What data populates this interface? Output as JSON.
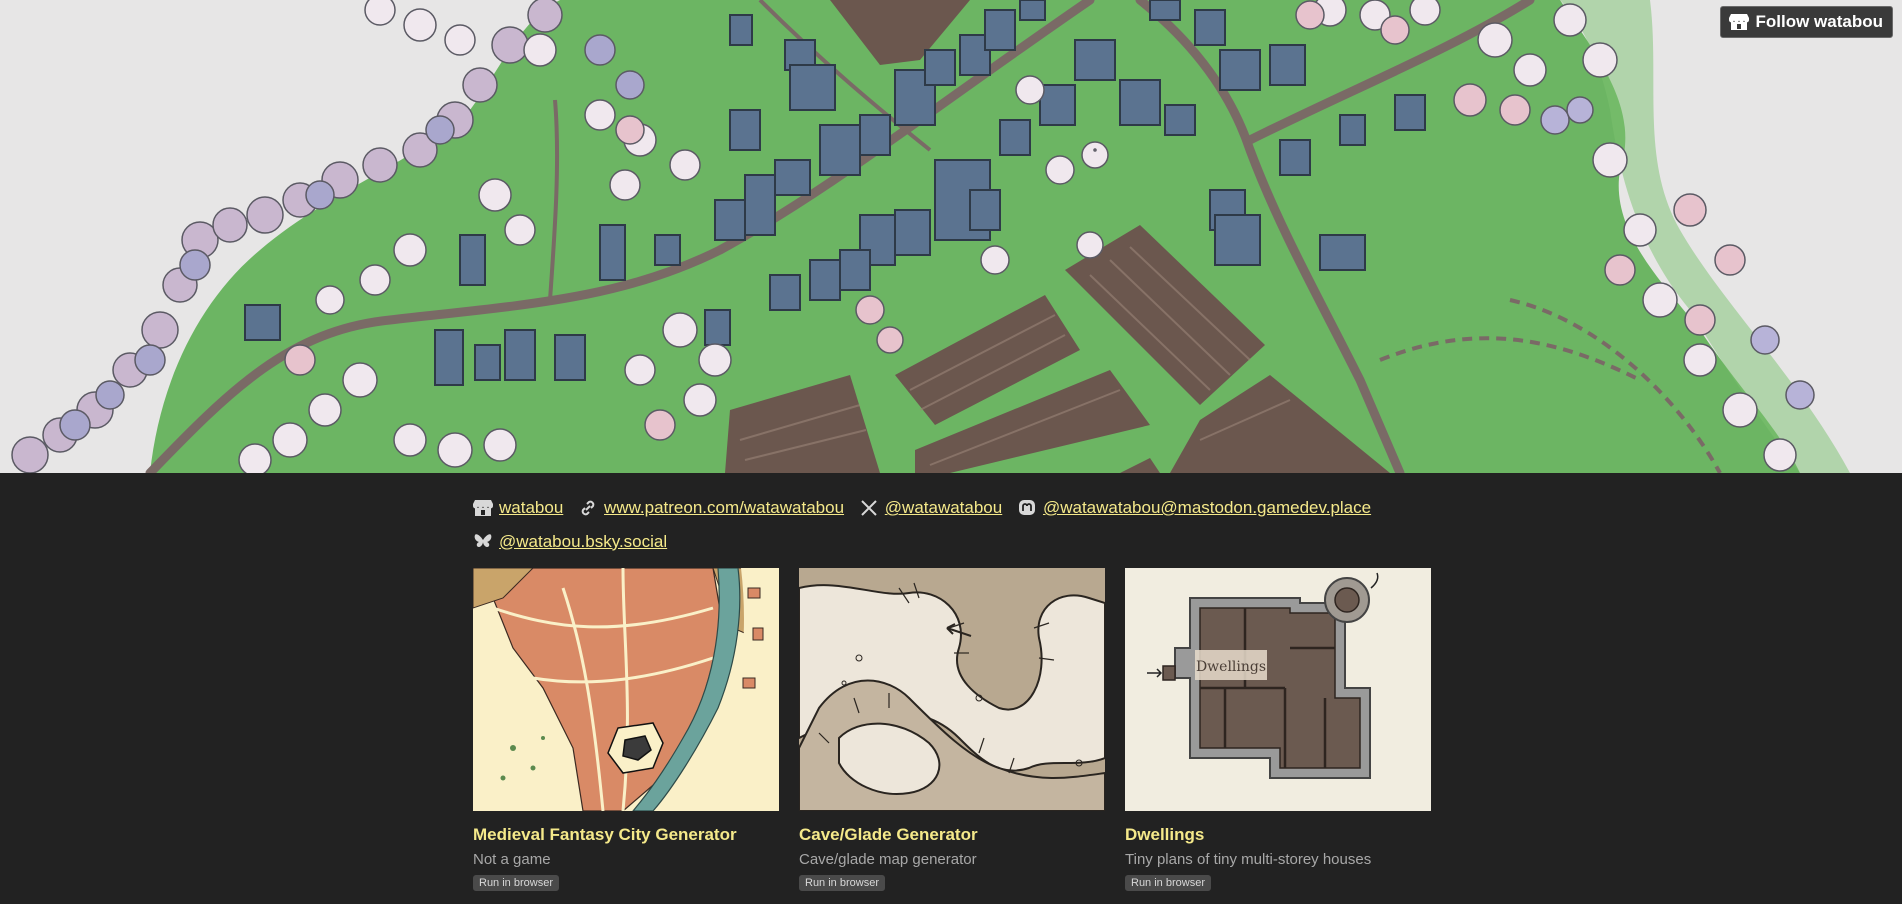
{
  "header": {
    "follow_label": "Follow watabou",
    "follow_icon": "itchio-icon"
  },
  "links": [
    {
      "icon": "itchio-icon",
      "text": "watabou"
    },
    {
      "icon": "link-icon",
      "text": "www.patreon.com/watawatabou"
    },
    {
      "icon": "x-icon",
      "text": "@watawatabou"
    },
    {
      "icon": "mastodon-icon",
      "text": "@watawatabou@mastodon.gamedev.place"
    },
    {
      "icon": "bluesky-icon",
      "text": "@watabou.bsky.social"
    }
  ],
  "games": [
    {
      "title": "Medieval Fantasy City Generator",
      "desc": "Not a game",
      "badge": "Run in browser"
    },
    {
      "title": "Cave/Glade Generator",
      "desc": "Cave/glade map generator",
      "badge": "Run in browser"
    },
    {
      "title": "Dwellings",
      "desc": "Tiny plans of tiny multi-storey houses",
      "badge": "Run in browser",
      "thumb_label": "Dwellings"
    }
  ],
  "colors": {
    "background": "#222222",
    "link": "#f5e98a",
    "grass": "#6cb563",
    "field": "#6b574e",
    "roof": "#5b7390"
  }
}
